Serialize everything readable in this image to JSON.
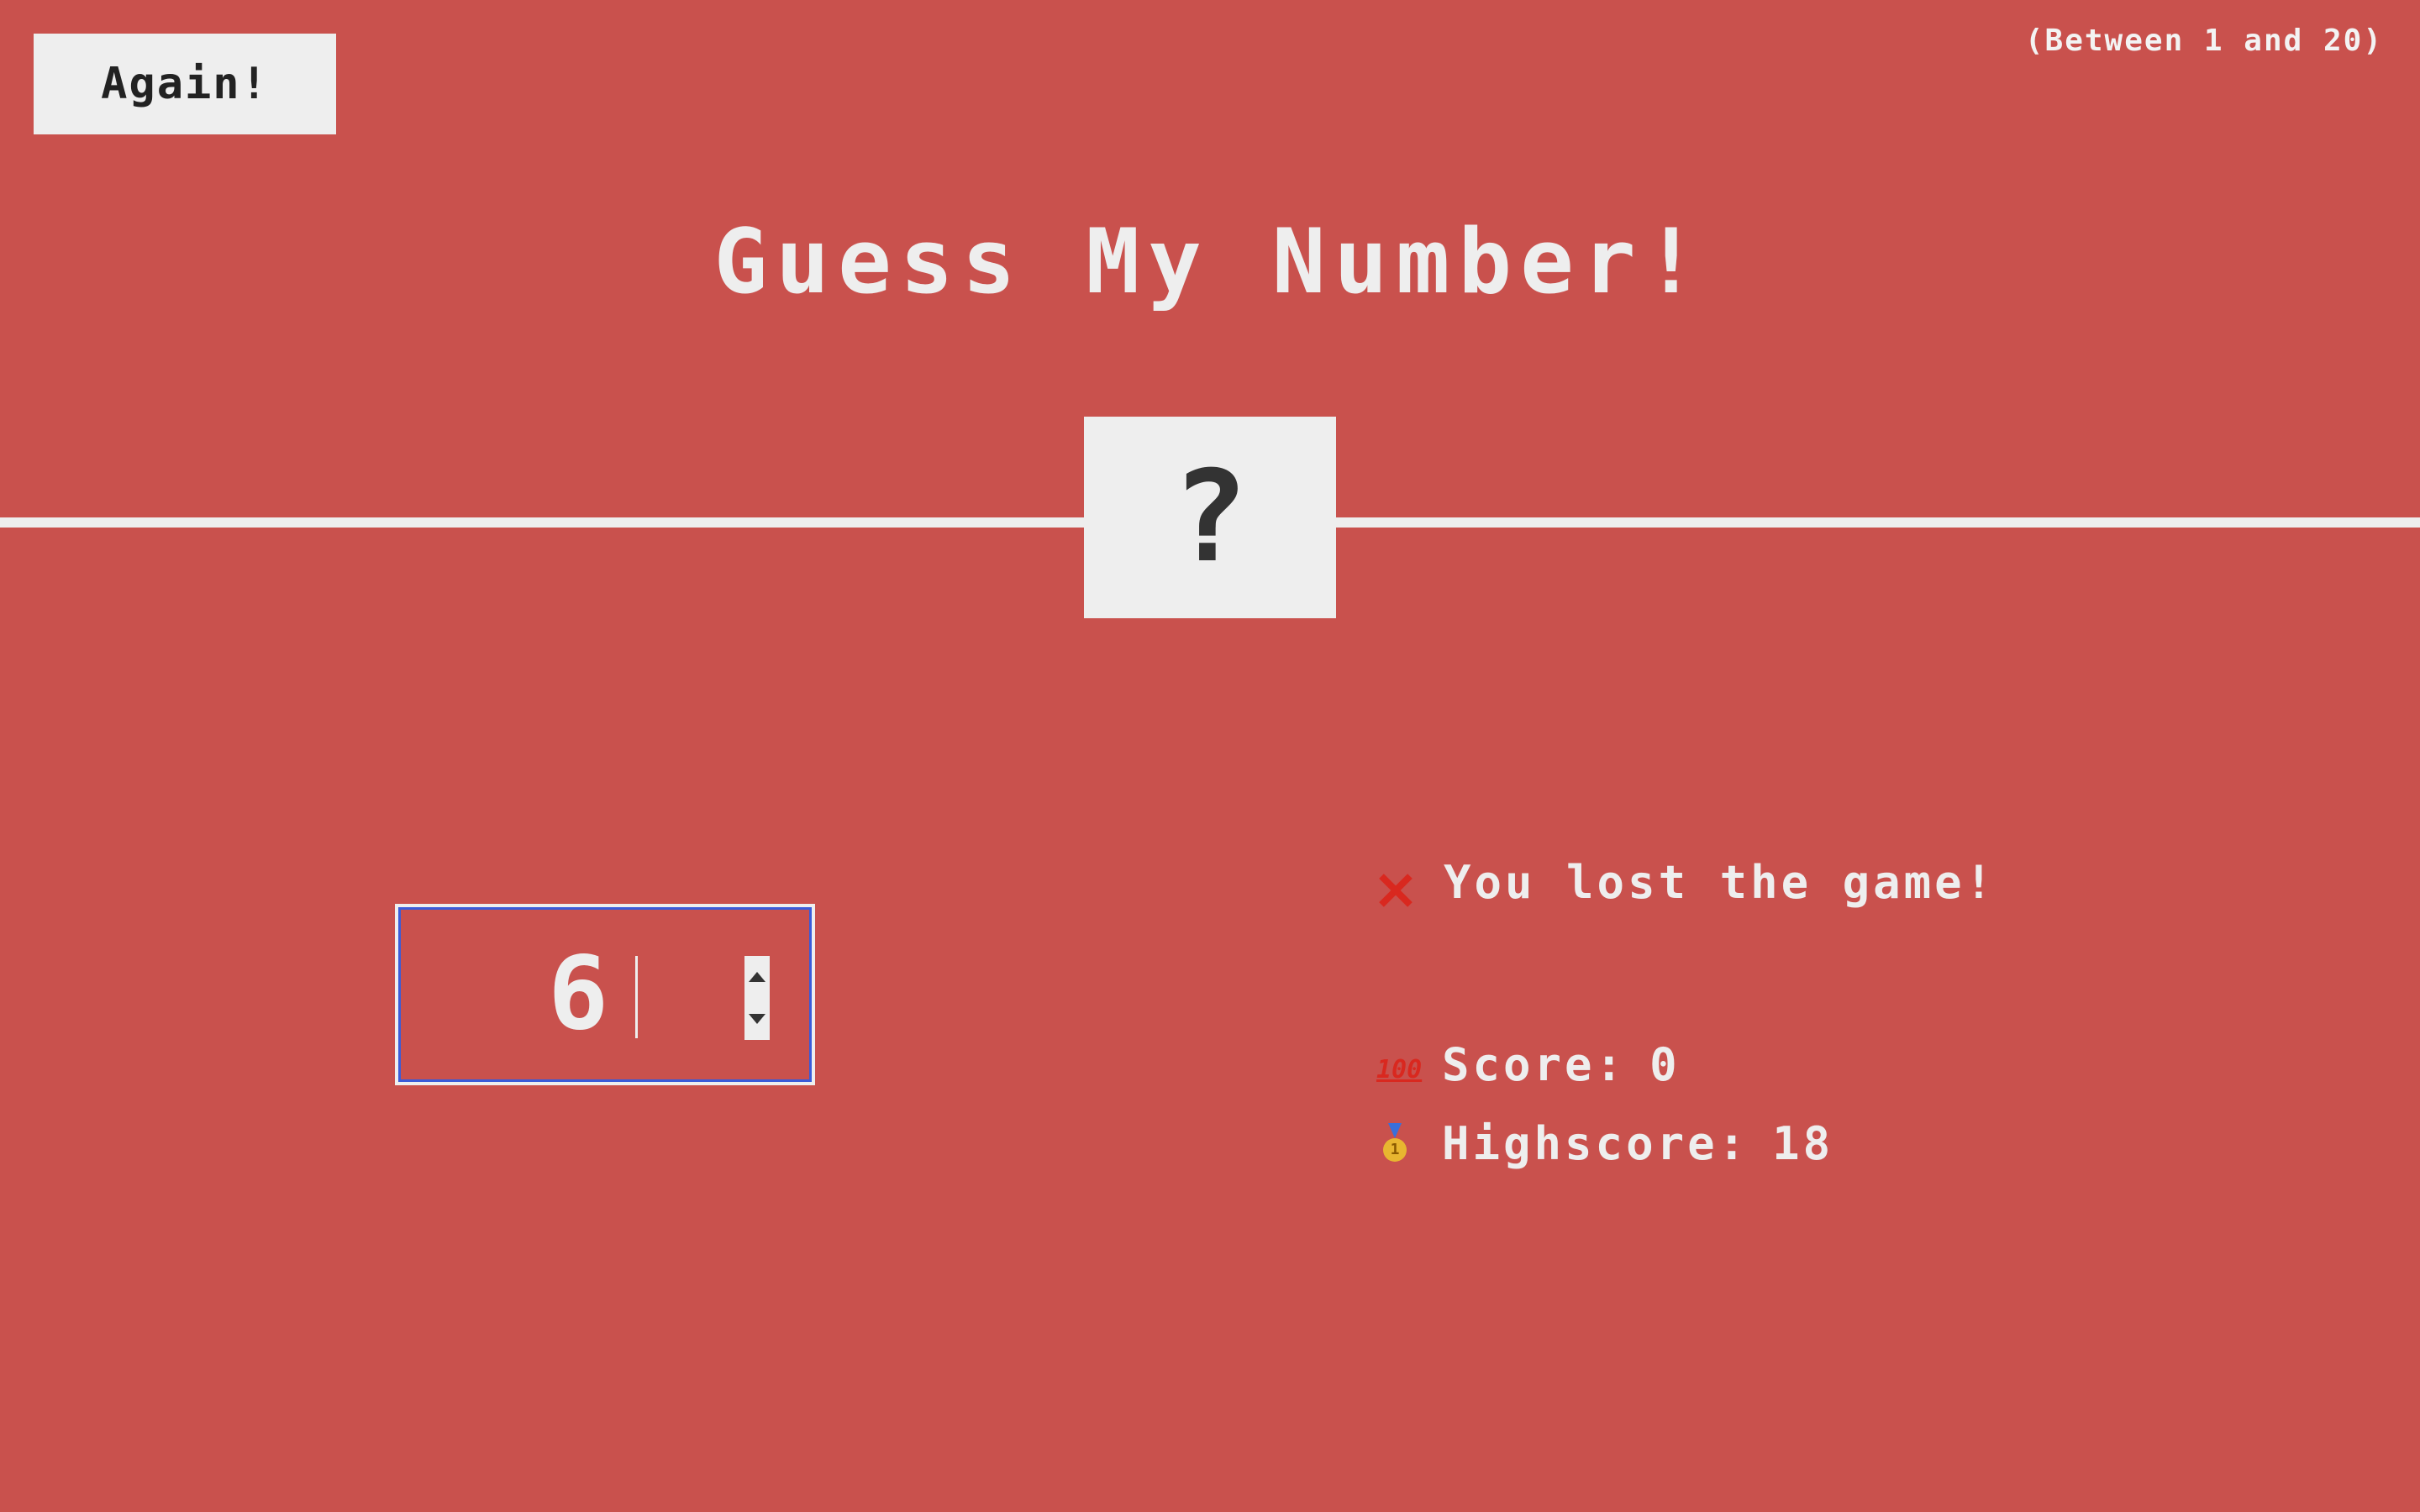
{
  "header": {
    "again_label": "Again!",
    "range_hint": "(Between 1 and 20)"
  },
  "title": "Guess My Number!",
  "secret": {
    "display": "?"
  },
  "guess": {
    "value": "6"
  },
  "status": {
    "message": "You lost the game!",
    "icon": "cross-mark-icon"
  },
  "score": {
    "label": "Score:",
    "value": "0",
    "icon": "hundred-points-icon"
  },
  "highscore": {
    "label": "Highscore:",
    "value": "18",
    "icon": "medal-icon"
  },
  "colors": {
    "background": "#c9514d",
    "foreground": "#eeeeee",
    "focus_ring": "#3a5bd9",
    "cross": "#d9281f"
  }
}
